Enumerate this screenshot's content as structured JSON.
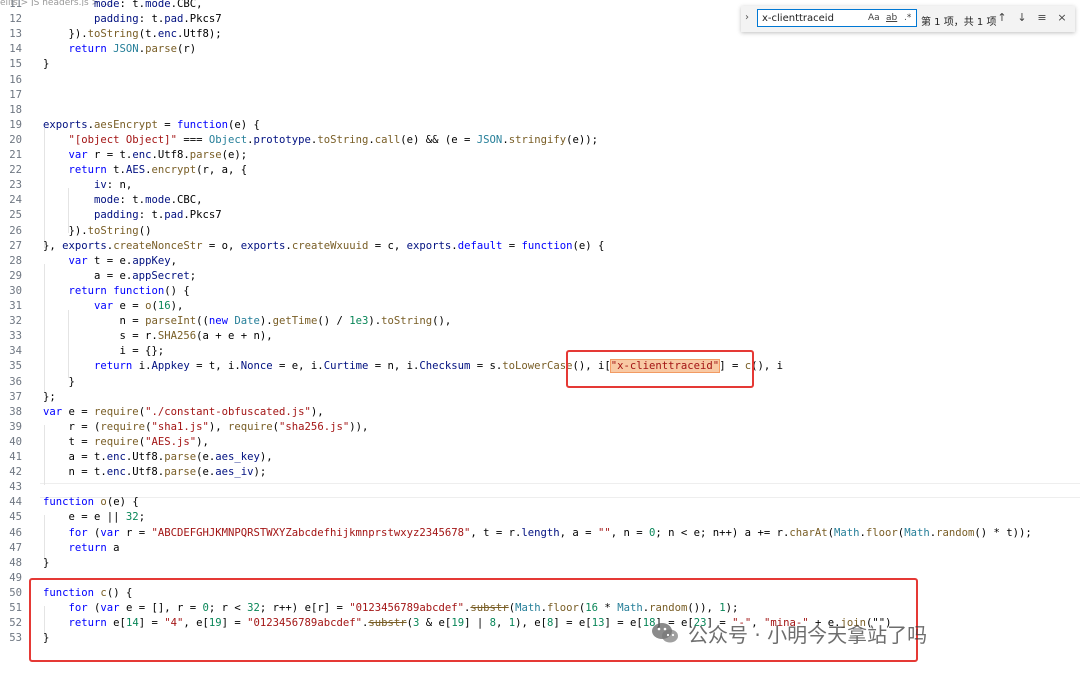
{
  "breadcrumb": "ellis > JS headers.js > ...",
  "search": {
    "value": "x-clienttraceid",
    "match_case_label": "Aa",
    "whole_word_label": "ab",
    "regex_label": ".*",
    "result_count": "第 1 项，共 1 项"
  },
  "watermark": "公众号 · 小明今天拿站了吗",
  "icons": {
    "expand": "chevron-right-icon",
    "prev": "arrow-up-icon",
    "next": "arrow-down-icon",
    "selection": "filter-lines-icon",
    "close": "close-icon",
    "wechat": "wechat-icon"
  },
  "code_lines": [
    {
      "n": "11",
      "parts": [
        [
          "",
          "        "
        ],
        [
          "var",
          "mode"
        ],
        [
          "",
          ": t."
        ],
        [
          "var",
          "mode"
        ],
        [
          "",
          ".CBC,"
        ]
      ]
    },
    {
      "n": "12",
      "parts": [
        [
          "",
          "        "
        ],
        [
          "var",
          "padding"
        ],
        [
          "",
          ": t."
        ],
        [
          "var",
          "pad"
        ],
        [
          "",
          ".Pkcs7"
        ]
      ]
    },
    {
      "n": "13",
      "parts": [
        [
          "",
          "    })."
        ],
        [
          "fn",
          "toString"
        ],
        [
          "",
          "(t."
        ],
        [
          "var",
          "enc"
        ],
        [
          "",
          ".Utf8);"
        ]
      ]
    },
    {
      "n": "14",
      "parts": [
        [
          "",
          "    "
        ],
        [
          "kw",
          "return"
        ],
        [
          "",
          ""
        ],
        [
          "typ",
          " JSON"
        ],
        [
          "",
          "."
        ],
        [
          "fn",
          "parse"
        ],
        [
          "",
          "(r)"
        ]
      ]
    },
    {
      "n": "15",
      "parts": [
        [
          "",
          "}"
        ]
      ]
    },
    {
      "n": "16",
      "parts": []
    },
    {
      "n": "17",
      "parts": []
    },
    {
      "n": "18",
      "parts": []
    },
    {
      "n": "19",
      "parts": [
        [
          "var",
          "exports"
        ],
        [
          "",
          "."
        ],
        [
          "fn",
          "aesEncrypt"
        ],
        [
          "",
          " = "
        ],
        [
          "kw",
          "function"
        ],
        [
          "",
          "(e) {"
        ]
      ]
    },
    {
      "n": "20",
      "parts": [
        [
          "",
          "    "
        ],
        [
          "str",
          "\"[object Object]\""
        ],
        [
          "",
          " === "
        ],
        [
          "typ",
          "Object"
        ],
        [
          "",
          "."
        ],
        [
          "var",
          "prototype"
        ],
        [
          "",
          "."
        ],
        [
          "fn",
          "toString"
        ],
        [
          "",
          "."
        ],
        [
          "fn",
          "call"
        ],
        [
          "",
          "(e) && (e = "
        ],
        [
          "typ",
          "JSON"
        ],
        [
          "",
          "."
        ],
        [
          "fn",
          "stringify"
        ],
        [
          "",
          "(e));"
        ]
      ]
    },
    {
      "n": "21",
      "parts": [
        [
          "",
          "    "
        ],
        [
          "kw",
          "var"
        ],
        [
          "",
          " r = t."
        ],
        [
          "var",
          "enc"
        ],
        [
          "",
          ".Utf8."
        ],
        [
          "fn",
          "parse"
        ],
        [
          "",
          "(e);"
        ]
      ]
    },
    {
      "n": "22",
      "parts": [
        [
          "",
          "    "
        ],
        [
          "kw",
          "return"
        ],
        [
          "",
          " t."
        ],
        [
          "var",
          "AES"
        ],
        [
          "",
          "."
        ],
        [
          "fn",
          "encrypt"
        ],
        [
          "",
          "(r, a, {"
        ]
      ]
    },
    {
      "n": "23",
      "parts": [
        [
          "",
          "        "
        ],
        [
          "var",
          "iv"
        ],
        [
          "",
          ": n,"
        ]
      ]
    },
    {
      "n": "24",
      "parts": [
        [
          "",
          "        "
        ],
        [
          "var",
          "mode"
        ],
        [
          "",
          ": t."
        ],
        [
          "var",
          "mode"
        ],
        [
          "",
          ".CBC,"
        ]
      ]
    },
    {
      "n": "25",
      "parts": [
        [
          "",
          "        "
        ],
        [
          "var",
          "padding"
        ],
        [
          "",
          ": t."
        ],
        [
          "var",
          "pad"
        ],
        [
          "",
          ".Pkcs7"
        ]
      ]
    },
    {
      "n": "26",
      "parts": [
        [
          "",
          "    })."
        ],
        [
          "fn",
          "toString"
        ],
        [
          "",
          "()"
        ]
      ]
    },
    {
      "n": "27",
      "parts": [
        [
          "",
          "}, "
        ],
        [
          "var",
          "exports"
        ],
        [
          "",
          "."
        ],
        [
          "fn",
          "createNonceStr"
        ],
        [
          "",
          " = o, "
        ],
        [
          "var",
          "exports"
        ],
        [
          "",
          "."
        ],
        [
          "fn",
          "createWxuuid"
        ],
        [
          "",
          " = c, "
        ],
        [
          "var",
          "exports"
        ],
        [
          "",
          "."
        ],
        [
          "kw",
          "default"
        ],
        [
          "",
          " = "
        ],
        [
          "kw",
          "function"
        ],
        [
          "",
          "(e) {"
        ]
      ]
    },
    {
      "n": "28",
      "parts": [
        [
          "",
          "    "
        ],
        [
          "kw",
          "var"
        ],
        [
          "",
          " t = e."
        ],
        [
          "var",
          "appKey"
        ],
        [
          "",
          ","
        ]
      ]
    },
    {
      "n": "29",
      "parts": [
        [
          "",
          "        a = e."
        ],
        [
          "var",
          "appSecret"
        ],
        [
          "",
          ";"
        ]
      ]
    },
    {
      "n": "30",
      "parts": [
        [
          "",
          "    "
        ],
        [
          "kw",
          "return"
        ],
        [
          "",
          " "
        ],
        [
          "kw",
          "function"
        ],
        [
          "",
          "() {"
        ]
      ]
    },
    {
      "n": "31",
      "parts": [
        [
          "",
          "        "
        ],
        [
          "kw",
          "var"
        ],
        [
          "",
          " e = "
        ],
        [
          "fn",
          "o"
        ],
        [
          "",
          "("
        ],
        [
          "num",
          "16"
        ],
        [
          "",
          "),"
        ]
      ]
    },
    {
      "n": "32",
      "parts": [
        [
          "",
          "            n = "
        ],
        [
          "fn",
          "parseInt"
        ],
        [
          "",
          "(("
        ],
        [
          "kw",
          "new"
        ],
        [
          "",
          " "
        ],
        [
          "typ",
          "Date"
        ],
        [
          "",
          ")."
        ],
        [
          "fn",
          "getTime"
        ],
        [
          "",
          "() / "
        ],
        [
          "num",
          "1e3"
        ],
        [
          "",
          ")."
        ],
        [
          "fn",
          "toString"
        ],
        [
          "",
          "(),"
        ]
      ]
    },
    {
      "n": "33",
      "parts": [
        [
          "",
          "            s = r."
        ],
        [
          "fn",
          "SHA256"
        ],
        [
          "",
          "(a + e + n),"
        ]
      ]
    },
    {
      "n": "34",
      "parts": [
        [
          "",
          "            i = {};"
        ]
      ]
    },
    {
      "n": "35",
      "parts": [
        [
          "",
          "        "
        ],
        [
          "kw",
          "return"
        ],
        [
          "",
          " i."
        ],
        [
          "var",
          "Appkey"
        ],
        [
          "",
          " = t, i."
        ],
        [
          "var",
          "Nonce"
        ],
        [
          "",
          " = e, i."
        ],
        [
          "var",
          "Curtime"
        ],
        [
          "",
          " = n, i."
        ],
        [
          "var",
          "Checksum"
        ],
        [
          "",
          " = s."
        ],
        [
          "fn",
          "toLowerCase"
        ],
        [
          "",
          "(), i["
        ],
        [
          "strm",
          "\"x-clienttraceid\""
        ],
        [
          "",
          "] = "
        ],
        [
          "fn",
          "c"
        ],
        [
          "",
          "(), i"
        ]
      ]
    },
    {
      "n": "36",
      "parts": [
        [
          "",
          "    }"
        ]
      ]
    },
    {
      "n": "37",
      "parts": [
        [
          "",
          "};"
        ]
      ]
    },
    {
      "n": "38",
      "parts": [
        [
          "kw",
          "var"
        ],
        [
          "",
          " e = "
        ],
        [
          "fn",
          "require"
        ],
        [
          "",
          "("
        ],
        [
          "str",
          "\"./constant-obfuscated.js\""
        ],
        [
          "",
          "),"
        ]
      ]
    },
    {
      "n": "39",
      "parts": [
        [
          "",
          "    r = ("
        ],
        [
          "fn",
          "require"
        ],
        [
          "",
          "("
        ],
        [
          "str",
          "\"sha1.js\""
        ],
        [
          "",
          "), "
        ],
        [
          "fn",
          "require"
        ],
        [
          "",
          "("
        ],
        [
          "str",
          "\"sha256.js\""
        ],
        [
          "",
          ")),"
        ]
      ]
    },
    {
      "n": "40",
      "parts": [
        [
          "",
          "    t = "
        ],
        [
          "fn",
          "require"
        ],
        [
          "",
          "("
        ],
        [
          "str",
          "\"AES.js\""
        ],
        [
          "",
          "),"
        ]
      ]
    },
    {
      "n": "41",
      "parts": [
        [
          "",
          "    a = t."
        ],
        [
          "var",
          "enc"
        ],
        [
          "",
          ".Utf8."
        ],
        [
          "fn",
          "parse"
        ],
        [
          "",
          "(e."
        ],
        [
          "var",
          "aes_key"
        ],
        [
          "",
          "),"
        ]
      ]
    },
    {
      "n": "42",
      "parts": [
        [
          "",
          "    n = t."
        ],
        [
          "var",
          "enc"
        ],
        [
          "",
          ".Utf8."
        ],
        [
          "fn",
          "parse"
        ],
        [
          "",
          "(e."
        ],
        [
          "var",
          "aes_iv"
        ],
        [
          "",
          ");"
        ]
      ]
    },
    {
      "n": "43",
      "parts": []
    },
    {
      "n": "44",
      "parts": [
        [
          "kw",
          "function"
        ],
        [
          "",
          " "
        ],
        [
          "fn",
          "o"
        ],
        [
          "",
          "(e) {"
        ]
      ]
    },
    {
      "n": "45",
      "parts": [
        [
          "",
          "    e = e || "
        ],
        [
          "num",
          "32"
        ],
        [
          "",
          ";"
        ]
      ]
    },
    {
      "n": "46",
      "parts": [
        [
          "",
          "    "
        ],
        [
          "kw",
          "for"
        ],
        [
          "",
          " ("
        ],
        [
          "kw",
          "var"
        ],
        [
          "",
          " r = "
        ],
        [
          "str",
          "\"ABCDEFGHJKMNPQRSTWXYZabcdefhijkmnprstwxyz2345678\""
        ],
        [
          "",
          ", t = r."
        ],
        [
          "var",
          "length"
        ],
        [
          "",
          ", a = "
        ],
        [
          "str",
          "\"\""
        ],
        [
          "",
          ", n = "
        ],
        [
          "num",
          "0"
        ],
        [
          "",
          "; n < e; n++) a += r."
        ],
        [
          "fn",
          "charAt"
        ],
        [
          "",
          "("
        ],
        [
          "typ",
          "Math"
        ],
        [
          "",
          "."
        ],
        [
          "fn",
          "floor"
        ],
        [
          "",
          "("
        ],
        [
          "typ",
          "Math"
        ],
        [
          "",
          "."
        ],
        [
          "fn",
          "random"
        ],
        [
          "",
          "() * t));"
        ]
      ]
    },
    {
      "n": "47",
      "parts": [
        [
          "",
          "    "
        ],
        [
          "kw",
          "return"
        ],
        [
          "",
          " a"
        ]
      ]
    },
    {
      "n": "48",
      "parts": [
        [
          "",
          "}"
        ]
      ]
    },
    {
      "n": "49",
      "parts": []
    },
    {
      "n": "50",
      "parts": [
        [
          "kw",
          "function"
        ],
        [
          "",
          " "
        ],
        [
          "fn",
          "c"
        ],
        [
          "",
          "() {"
        ]
      ]
    },
    {
      "n": "51",
      "parts": [
        [
          "",
          "    "
        ],
        [
          "kw",
          "for"
        ],
        [
          "",
          " ("
        ],
        [
          "kw",
          "var"
        ],
        [
          "",
          " e = [], r = "
        ],
        [
          "num",
          "0"
        ],
        [
          "",
          "; r < "
        ],
        [
          "num",
          "32"
        ],
        [
          "",
          "; r++) e[r] = "
        ],
        [
          "str",
          "\"0123456789abcdef\""
        ],
        [
          "",
          "."
        ],
        [
          "strike",
          "substr"
        ],
        [
          "",
          "("
        ],
        [
          "typ",
          "Math"
        ],
        [
          "",
          "."
        ],
        [
          "fn",
          "floor"
        ],
        [
          "",
          "("
        ],
        [
          "num",
          "16"
        ],
        [
          "",
          " * "
        ],
        [
          "typ",
          "Math"
        ],
        [
          "",
          "."
        ],
        [
          "fn",
          "random"
        ],
        [
          "",
          "()), "
        ],
        [
          "num",
          "1"
        ],
        [
          "",
          ");"
        ]
      ]
    },
    {
      "n": "52",
      "parts": [
        [
          "",
          "    "
        ],
        [
          "kw",
          "return"
        ],
        [
          "",
          " e["
        ],
        [
          "num",
          "14"
        ],
        [
          "",
          "] = "
        ],
        [
          "str",
          "\"4\""
        ],
        [
          "",
          ", e["
        ],
        [
          "num",
          "19"
        ],
        [
          "",
          "] = "
        ],
        [
          "str",
          "\"0123456789abcdef\""
        ],
        [
          "",
          "."
        ],
        [
          "strike",
          "substr"
        ],
        [
          "",
          "("
        ],
        [
          "num",
          "3"
        ],
        [
          "",
          " & e["
        ],
        [
          "num",
          "19"
        ],
        [
          "",
          "] | "
        ],
        [
          "num",
          "8"
        ],
        [
          "",
          ", "
        ],
        [
          "num",
          "1"
        ],
        [
          "",
          "), e["
        ],
        [
          "num",
          "8"
        ],
        [
          "",
          "] = e["
        ],
        [
          "num",
          "13"
        ],
        [
          "",
          "] = e["
        ],
        [
          "num",
          "18"
        ],
        [
          "",
          "] = e["
        ],
        [
          "num",
          "23"
        ],
        [
          "",
          "] = "
        ],
        [
          "str",
          "\"-\""
        ],
        [
          "",
          ", "
        ],
        [
          "str",
          "\"mina-\""
        ],
        [
          "",
          " + e."
        ],
        [
          "fn",
          "join"
        ],
        [
          "",
          "(\"\")"
        ]
      ]
    },
    {
      "n": "53",
      "parts": [
        [
          "",
          "}"
        ]
      ]
    }
  ]
}
